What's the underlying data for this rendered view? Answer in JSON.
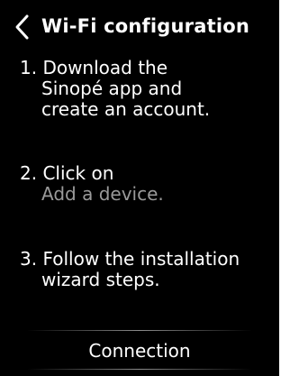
{
  "header": {
    "back_icon": "chevron-left-icon",
    "title": "Wi-Fi configuration"
  },
  "steps": [
    {
      "lines": [
        "1. Download the",
        "Sinopé app and",
        "create an account."
      ]
    },
    {
      "lines": [
        "2. Click on",
        "Add a device."
      ]
    },
    {
      "lines": [
        "3. Follow the installation",
        "wizard steps."
      ]
    }
  ],
  "footer": {
    "connection_label": "Connection"
  },
  "colors": {
    "background": "#000000",
    "text": "#ffffff",
    "muted": "#9a9a9a"
  }
}
